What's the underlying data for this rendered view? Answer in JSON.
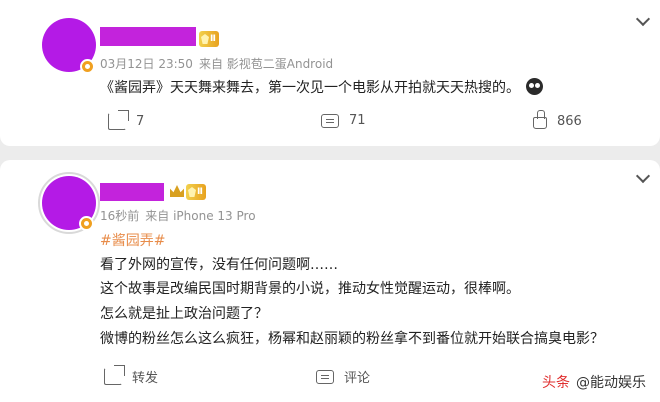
{
  "posts": [
    {
      "time": "03月12日 23:50",
      "source": "来自 影视苞二蛋Android",
      "level": "Ⅱ",
      "content": "《酱园弄》天天舞来舞去，第一次见一个电影从开拍就天天热搜的。",
      "actions": {
        "share": "7",
        "comment": "71",
        "like": "866"
      }
    },
    {
      "time": "16秒前",
      "source": "来自 iPhone 13 Pro",
      "level": "Ⅱ",
      "hashtag": "#酱园弄#",
      "lines": [
        "看了外网的宣传，没有任何问题啊……",
        "这个故事是改编民国时期背景的小说，推动女性觉醒运动，很棒啊。",
        "怎么就是扯上政治问题了？",
        "微博的粉丝怎么这么疯狂，杨幂和赵丽颖的粉丝拿不到番位就开始联合搞臭电影？"
      ],
      "actions": {
        "share": "转发",
        "comment": "评论"
      }
    }
  ],
  "watermark": {
    "brand": "头条",
    "account": "@能动娱乐"
  },
  "colors": {
    "avatar": "#b41ae6",
    "name_redaction": "#c323dc",
    "hashtag": "#e88c4a"
  }
}
